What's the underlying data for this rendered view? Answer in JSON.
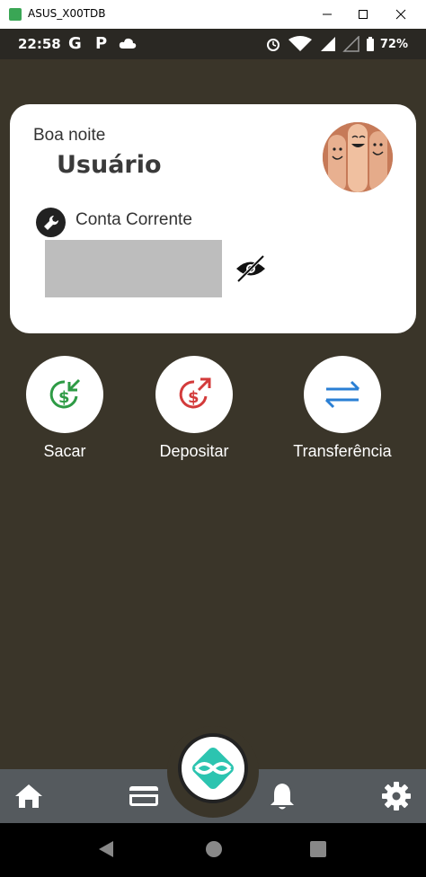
{
  "window": {
    "title": "ASUS_X00TDB",
    "minimize_label": "",
    "maximize_label": "",
    "close_label": ""
  },
  "status_bar": {
    "time": "22:58",
    "g_icon_text": "G",
    "p_icon_text": "P",
    "battery": "72%"
  },
  "card": {
    "greeting": "Boa noite",
    "username": "Usuário",
    "account_label": "Conta Corrente"
  },
  "actions": [
    {
      "label": "Sacar",
      "icon": "withdraw-icon",
      "color": "#2e9b45"
    },
    {
      "label": "Depositar",
      "icon": "deposit-icon",
      "color": "#d33b3b"
    },
    {
      "label": "Transferência",
      "icon": "transfer-icon",
      "color": "#2a7fd4"
    }
  ],
  "bottom_nav": {
    "items": [
      "home-icon",
      "card-icon",
      "pix-icon",
      "bell-icon",
      "gear-icon"
    ],
    "accent": "#2cc4b0"
  },
  "colors": {
    "background": "#3a3529",
    "card": "#ffffff",
    "nav": "#555a5e"
  }
}
